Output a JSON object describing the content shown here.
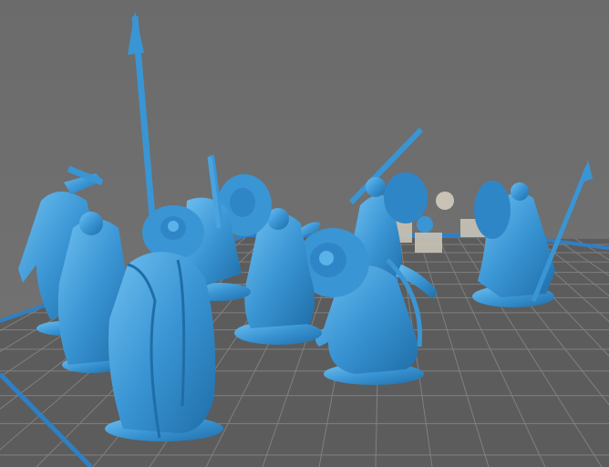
{
  "scene": {
    "subject": "miniature-figures-on-build-plate",
    "colors": {
      "background": "#6e6e6e",
      "plate_fill": "#5f5f5f",
      "grid_line": "#8a8a8a",
      "plate_border": "#2f7fc4",
      "model": "#3a95d4",
      "model_shade": "#1f6ea8",
      "model_highlight": "#6fc0f0",
      "support": "#c9c3b6"
    }
  }
}
